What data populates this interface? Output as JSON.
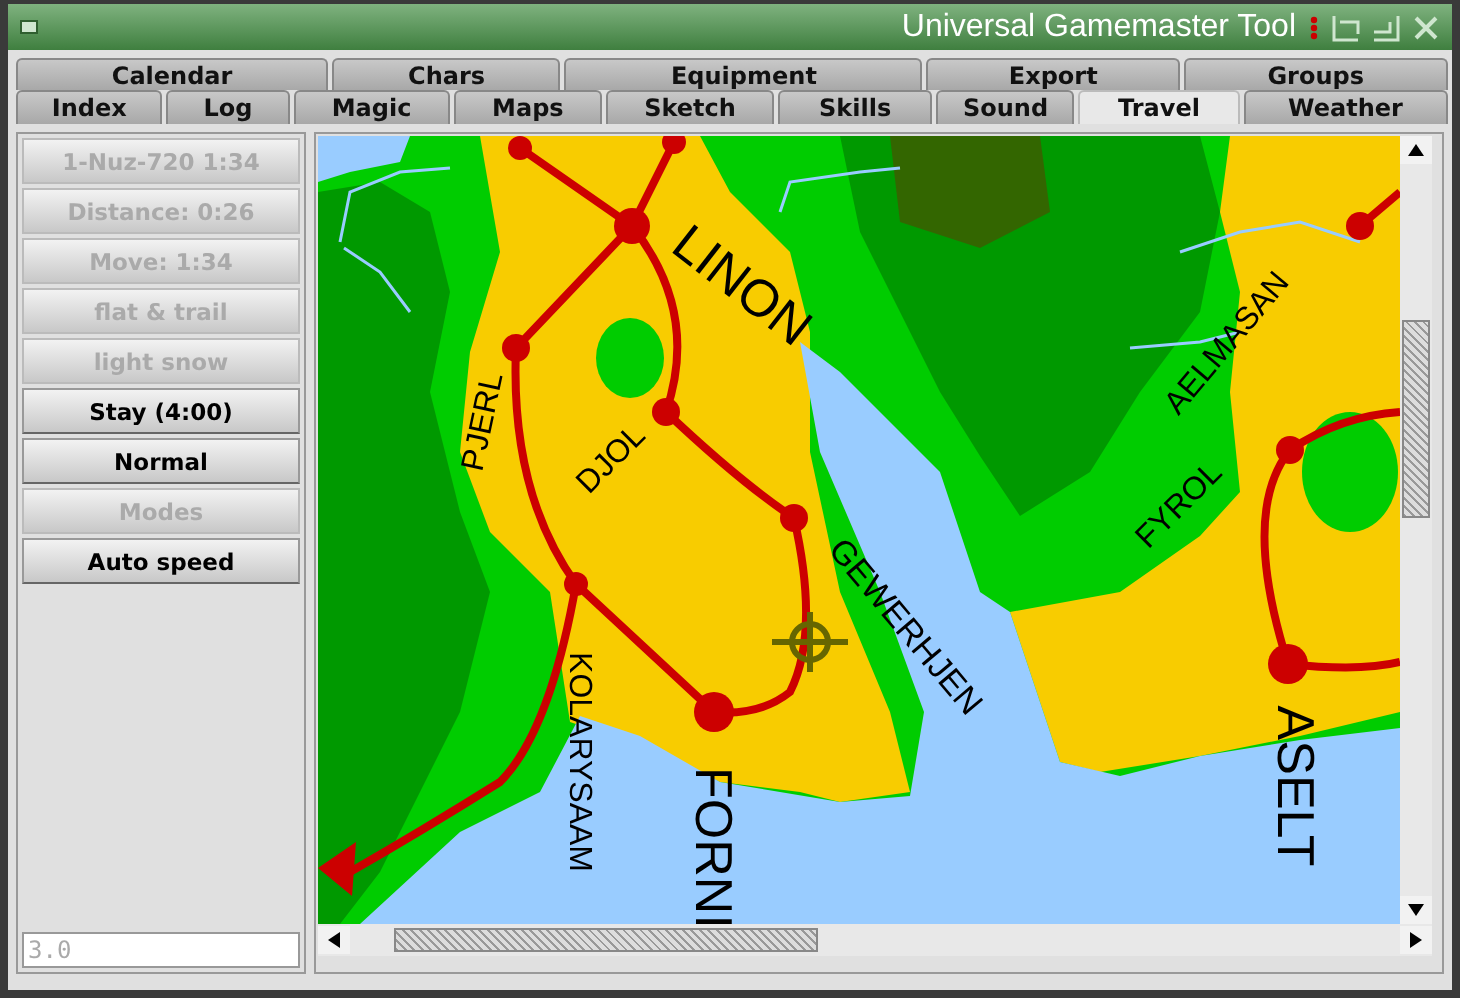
{
  "window": {
    "title": "Universal Gamemaster Tool"
  },
  "tabs": {
    "back_row": [
      {
        "label": "Calendar",
        "selected": false
      },
      {
        "label": "Chars",
        "selected": false
      },
      {
        "label": "Equipment",
        "selected": false
      },
      {
        "label": "Export",
        "selected": false
      },
      {
        "label": "Groups",
        "selected": false
      }
    ],
    "front_row": [
      {
        "label": "Index",
        "selected": false
      },
      {
        "label": "Log",
        "selected": false
      },
      {
        "label": "Magic",
        "selected": false
      },
      {
        "label": "Maps",
        "selected": false
      },
      {
        "label": "Sketch",
        "selected": false
      },
      {
        "label": "Skills",
        "selected": false
      },
      {
        "label": "Sound",
        "selected": false
      },
      {
        "label": "Travel",
        "selected": true
      },
      {
        "label": "Weather",
        "selected": false
      }
    ]
  },
  "sidebar": {
    "buttons": [
      {
        "label": "1-Nuz-720 1:34",
        "disabled": true
      },
      {
        "label": "Distance: 0:26",
        "disabled": true
      },
      {
        "label": "Move: 1:34",
        "disabled": true
      },
      {
        "label": "flat & trail",
        "disabled": true
      },
      {
        "label": "light snow",
        "disabled": true
      },
      {
        "label": "Stay (4:00)",
        "disabled": false
      },
      {
        "label": "Normal",
        "disabled": false
      },
      {
        "label": "Modes",
        "disabled": true
      },
      {
        "label": "Auto speed",
        "disabled": false
      }
    ],
    "field": {
      "value": "3.0",
      "disabled": true
    }
  },
  "map": {
    "places": [
      {
        "name": "LINON"
      },
      {
        "name": "PJERL"
      },
      {
        "name": "DJOL"
      },
      {
        "name": "GEWERHJEN"
      },
      {
        "name": "KOLARYSAAM"
      },
      {
        "name": "FORNI"
      },
      {
        "name": "AELMASAN"
      },
      {
        "name": "FYROL"
      },
      {
        "name": "ASELT"
      }
    ]
  }
}
